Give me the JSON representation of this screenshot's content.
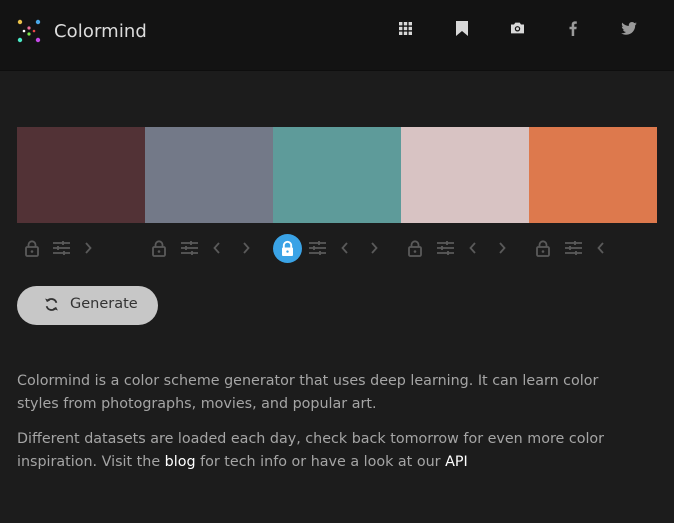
{
  "app": {
    "name": "Colormind",
    "logo_icon": "colormind-dots-logo"
  },
  "nav": {
    "icons": [
      "grid-icon",
      "bookmark-icon",
      "camera-icon",
      "facebook-icon",
      "twitter-icon"
    ]
  },
  "palette": {
    "colors": [
      "#523236",
      "#737988",
      "#5e9b9a",
      "#d8c3c3",
      "#dd794d"
    ],
    "lock_active_color": "#3aa3e6",
    "swatches": [
      {
        "index": 1,
        "color": "#523236",
        "locked": false,
        "controls": [
          "lock-icon",
          "adjust-icon",
          "chevron-right-icon"
        ]
      },
      {
        "index": 2,
        "color": "#737988",
        "locked": false,
        "controls": [
          "lock-icon",
          "adjust-icon",
          "chevron-left-icon",
          "chevron-right-icon"
        ]
      },
      {
        "index": 3,
        "color": "#5e9b9a",
        "locked": true,
        "controls": [
          "lock-icon",
          "adjust-icon",
          "chevron-left-icon",
          "chevron-right-icon"
        ]
      },
      {
        "index": 4,
        "color": "#d8c3c3",
        "locked": false,
        "controls": [
          "lock-icon",
          "adjust-icon",
          "chevron-left-icon",
          "chevron-right-icon"
        ]
      },
      {
        "index": 5,
        "color": "#dd794d",
        "locked": false,
        "controls": [
          "lock-icon",
          "adjust-icon",
          "chevron-left-icon"
        ]
      }
    ]
  },
  "generate": {
    "label": "Generate",
    "icon": "refresh-icon"
  },
  "description": {
    "para1": "Colormind is a color scheme generator that uses deep learning. It can learn color styles from photographs, movies, and popular art.",
    "para2_prefix": "Different datasets are loaded each day, check back tomorrow for even more color inspiration. Visit the ",
    "blog_link": "blog",
    "para2_middle": " for tech info or have a look at our ",
    "api_link": "API"
  }
}
